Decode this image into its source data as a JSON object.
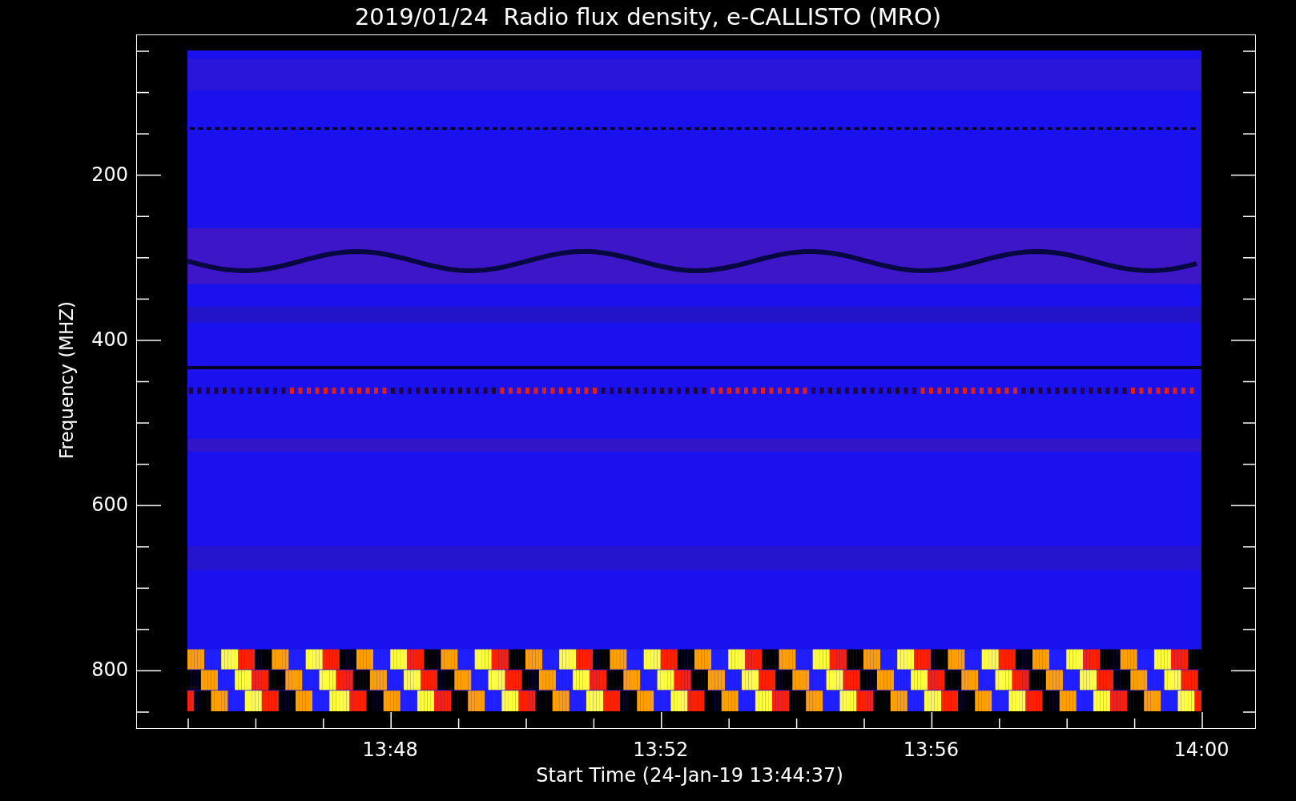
{
  "title": "2019/01/24  Radio flux density, e-CALLISTO (MRO)",
  "y_axis": {
    "label": "Frequency (MHZ)",
    "ticks": [
      "200",
      "400",
      "600",
      "800"
    ]
  },
  "x_axis": {
    "label": "Start Time (24-Jan-19 13:44:37)",
    "ticks": [
      "13:48",
      "13:52",
      "13:56",
      "14:00"
    ]
  }
}
